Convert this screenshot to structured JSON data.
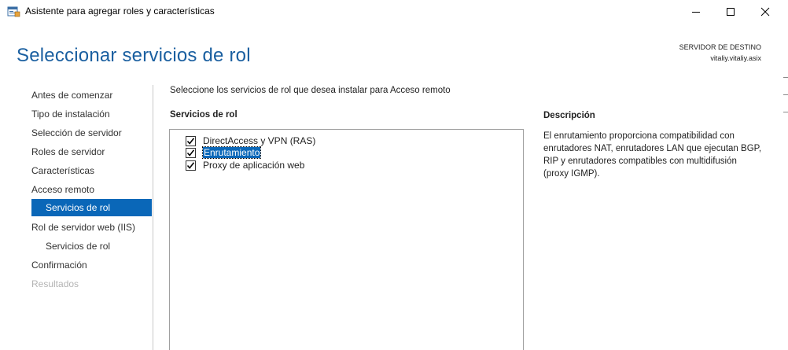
{
  "window": {
    "title": "Asistente para agregar roles y características"
  },
  "header": {
    "page_title": "Seleccionar servicios de rol",
    "destination_label": "SERVIDOR DE DESTINO",
    "destination_server": "vitaliy.vitaliy.asix"
  },
  "nav": {
    "items": [
      {
        "label": "Antes de comenzar"
      },
      {
        "label": "Tipo de instalación"
      },
      {
        "label": "Selección de servidor"
      },
      {
        "label": "Roles de servidor"
      },
      {
        "label": "Características"
      },
      {
        "label": "Acceso remoto"
      },
      {
        "label": "Servicios de rol"
      },
      {
        "label": "Rol de servidor web (IIS)"
      },
      {
        "label": "Servicios de rol"
      },
      {
        "label": "Confirmación"
      },
      {
        "label": "Resultados"
      }
    ]
  },
  "main": {
    "instruction": "Seleccione los servicios de rol que desea instalar para Acceso remoto",
    "services_header": "Servicios de rol",
    "services": [
      {
        "label": "DirectAccess y VPN (RAS)",
        "checked": true
      },
      {
        "label": "Enrutamiento",
        "checked": true
      },
      {
        "label": "Proxy de aplicación web",
        "checked": true
      }
    ],
    "description_header": "Descripción",
    "description_text": "El enrutamiento proporciona compatibilidad con enrutadores NAT, enrutadores LAN que ejecutan BGP, RIP y enrutadores compatibles con multidifusión (proxy IGMP)."
  },
  "colors": {
    "accent": "#0a67b8",
    "title_blue": "#1a5fa0"
  }
}
